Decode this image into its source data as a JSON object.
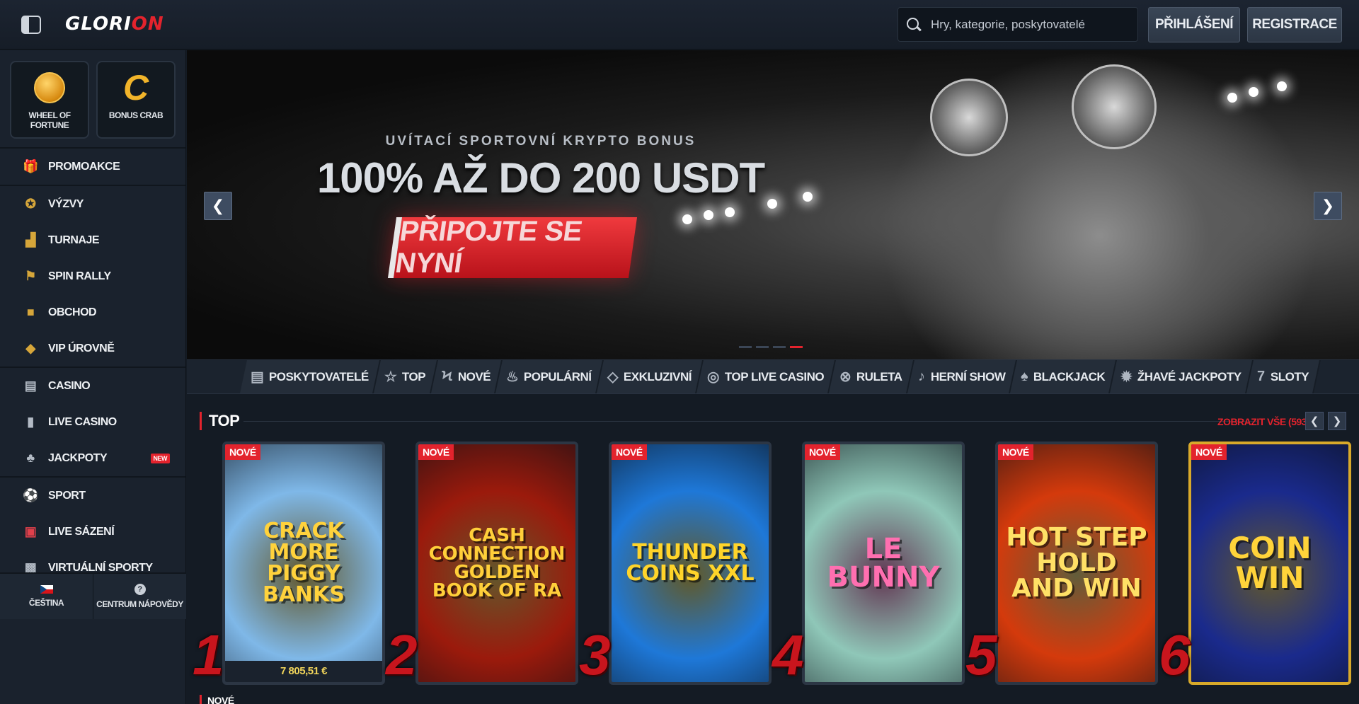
{
  "header": {
    "logo_main": "GLORI",
    "logo_accent": "ON",
    "search_placeholder": "Hry, kategorie, poskytovatelé",
    "login_label": "PŘIHLÁŠENÍ",
    "register_label": "REGISTRACE"
  },
  "sidebar": {
    "tiles": [
      {
        "label": "WHEEL OF FORTUNE",
        "icon": "wheel-icon"
      },
      {
        "label": "BONUS CRAB",
        "icon": "crab-icon"
      }
    ],
    "groups": [
      [
        {
          "label": "PROMOAKCE",
          "icon": "gift-icon"
        }
      ],
      [
        {
          "label": "VÝZVY",
          "icon": "medal-icon"
        },
        {
          "label": "TURNAJE",
          "icon": "podium-icon"
        },
        {
          "label": "SPIN RALLY",
          "icon": "flag-checkered-icon"
        },
        {
          "label": "OBCHOD",
          "icon": "basket-icon"
        },
        {
          "label": "VIP ÚROVNĚ",
          "icon": "diamond-icon"
        }
      ],
      [
        {
          "label": "CASINO",
          "icon": "slot-machine-icon"
        },
        {
          "label": "LIVE CASINO",
          "icon": "card-icon"
        },
        {
          "label": "JACKPOTY",
          "icon": "clover-icon",
          "badge": "NEW"
        }
      ],
      [
        {
          "label": "SPORT",
          "icon": "ball-icon"
        },
        {
          "label": "LIVE SÁZENÍ",
          "icon": "live-icon"
        },
        {
          "label": "VIRTUÁLNÍ SPORTY",
          "icon": "virtual-sport-icon"
        }
      ]
    ],
    "language_label": "ČEŠTINA",
    "help_label": "CENTRUM NÁPOVĚDY"
  },
  "hero": {
    "subtitle": "UVÍTACÍ SPORTOVNÍ KRYPTO BONUS",
    "title": "100% AŽ DO 200 USDT",
    "cta": "PŘIPOJTE SE NYNÍ",
    "active_slide": 3,
    "slide_count": 4
  },
  "categories": [
    {
      "label": "POSKYTOVATELÉ",
      "icon": "clipboard-icon"
    },
    {
      "label": "TOP",
      "icon": "star-icon"
    },
    {
      "label": "NOVÉ",
      "icon": "lightning-icon"
    },
    {
      "label": "POPULÁRNÍ",
      "icon": "fire-icon"
    },
    {
      "label": "EXKLUZIVNÍ",
      "icon": "diamond-icon"
    },
    {
      "label": "TOP LIVE CASINO",
      "icon": "chip-icon"
    },
    {
      "label": "RULETA",
      "icon": "roulette-icon"
    },
    {
      "label": "HERNÍ SHOW",
      "icon": "microphone-icon"
    },
    {
      "label": "BLACKJACK",
      "icon": "cards-icon"
    },
    {
      "label": "ŽHAVÉ JACKPOTY",
      "icon": "hot-icon"
    },
    {
      "label": "SLOTY",
      "icon": "slot-icon"
    }
  ],
  "top_section": {
    "title": "TOP",
    "view_all": "ZOBRAZIT VŠE (593)",
    "games": [
      {
        "rank": "1",
        "badge": "NOVÉ",
        "name": "CRACK MORE PIGGY BANKS",
        "jackpot": "7 805,51 €",
        "bg": "#7fb8e8",
        "fg": "#ffd23c"
      },
      {
        "rank": "2",
        "badge": "NOVÉ",
        "name": "CASH CONNECTION GOLDEN BOOK OF RA",
        "bg": "#9b1a0c",
        "fg": "#ffcf3a"
      },
      {
        "rank": "3",
        "badge": "NOVÉ",
        "name": "THUNDER COINS XXL",
        "bg": "#1e78d8",
        "fg": "#ffd42a"
      },
      {
        "rank": "4",
        "badge": "NOVÉ",
        "name": "LE BUNNY",
        "bg": "#8fc7b8",
        "fg": "#ff6fb0"
      },
      {
        "rank": "5",
        "badge": "NOVÉ",
        "name": "HOT STEP HOLD AND WIN",
        "bg": "#d43a0c",
        "fg": "#ffe066"
      },
      {
        "rank": "6",
        "badge": "NOVÉ",
        "name": "COIN WIN",
        "bg": "#1a2a8c",
        "fg": "#ffd33a"
      }
    ]
  },
  "next_section_title": "NOVÉ"
}
